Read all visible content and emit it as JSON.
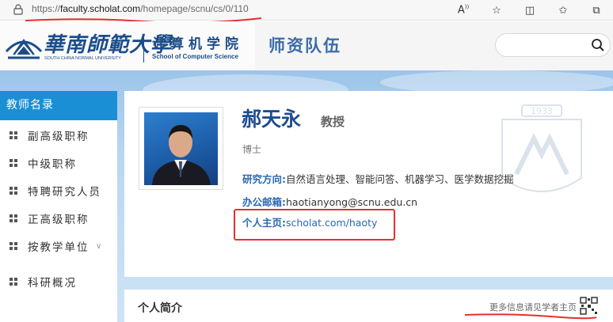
{
  "browser": {
    "url_prefix": "https://",
    "url_host": "faculty.scholat.com",
    "url_path": "/homepage/scnu/cs/0/110",
    "toolbar_icons": [
      "Â⁡",
      "☆",
      "◫",
      "☆≡",
      "…"
    ]
  },
  "header": {
    "univ_cn": "華南師範大學",
    "univ_en": "SOUTH CHINA NORMAL UNIVERSITY",
    "school_cn": "计算机学院",
    "school_en": "School of Computer Science",
    "section_title": "师资队伍",
    "search_placeholder": ""
  },
  "sidebar": {
    "heading": "教师名录",
    "items": [
      {
        "label": "副高级职称"
      },
      {
        "label": "中级职称"
      },
      {
        "label": "特聘研究人员"
      },
      {
        "label": "正高级职称"
      },
      {
        "label": "按教学单位",
        "chevron": "∨"
      },
      {
        "label": "科研概况"
      }
    ]
  },
  "profile": {
    "name": "郝天永",
    "rank": "教授",
    "degree": "博士",
    "research_label": "研究方向:",
    "research_value": "自然语言处理、智能问答、机器学习、医学数据挖掘",
    "email_label": "办公邮箱:",
    "email_value": "haotianyong@scnu.edu.cn",
    "homepage_label": "个人主页:",
    "homepage_value": "scholat.com/haoty",
    "watermark_year": "1933"
  },
  "intro": {
    "title": "个人简介",
    "more_text": "更多信息请见学者主页"
  },
  "colors": {
    "brand_blue": "#1c4d8a",
    "sidebar_active": "#1b8fd6",
    "link_blue": "#2a67b5",
    "annotation_red": "#e53030"
  }
}
